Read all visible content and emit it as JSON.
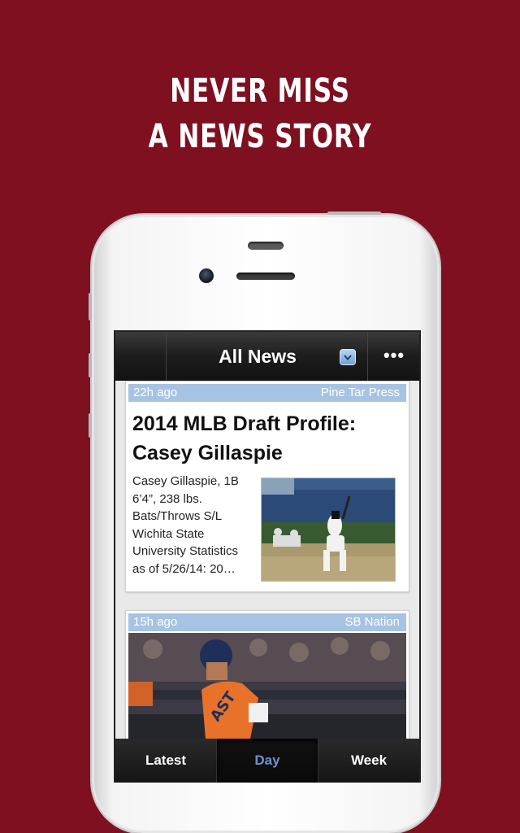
{
  "promo": {
    "line1": "NEVER MISS",
    "line2": "A NEWS STORY"
  },
  "nav": {
    "title": "All News",
    "dropdown_icon": "chevron-down-icon",
    "more_label": "•••"
  },
  "stories": [
    {
      "age": "22h ago",
      "source": "Pine Tar Press",
      "title": "2014 MLB Draft Profile: Casey Gillaspie",
      "summary": "Casey Gillaspie, 1B 6’4”, 238 lbs. Bats/Throws S/L Wichita State University Statistics as of 5/26/14: 20…"
    },
    {
      "age": "15h ago",
      "source": "SB Nation"
    }
  ],
  "tabs": {
    "latest": "Latest",
    "day": "Day",
    "week": "Week",
    "active": "Day"
  },
  "colors": {
    "background": "#7e1020",
    "meta_bar": "#a7c3e4",
    "active_tab": "#6a93cf"
  }
}
